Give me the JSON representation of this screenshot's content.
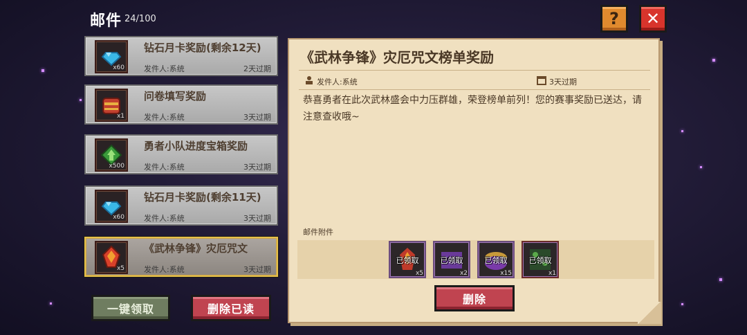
{
  "header": {
    "title": "邮件",
    "count": "24/100"
  },
  "buttons": {
    "help": "?",
    "close": "✕",
    "claim_all": "一键领取",
    "delete_read": "删除已读",
    "delete": "删除"
  },
  "mails": [
    {
      "title": "钻石月卡奖励(剩余12天)",
      "sender": "发件人:系统",
      "expire": "2天过期",
      "qty": "x60",
      "icon": "diamond-icon"
    },
    {
      "title": "问卷填写奖励",
      "sender": "发件人:系统",
      "expire": "3天过期",
      "qty": "x1",
      "icon": "chest-icon"
    },
    {
      "title": "勇者小队进度宝箱奖励",
      "sender": "发件人:系统",
      "expire": "3天过期",
      "qty": "x500",
      "icon": "green-gem-icon"
    },
    {
      "title": "钻石月卡奖励(剩余11天)",
      "sender": "发件人:系统",
      "expire": "3天过期",
      "qty": "x60",
      "icon": "diamond-icon"
    },
    {
      "title": "《武林争锋》灾厄咒文",
      "sender": "发件人:系统",
      "expire": "3天过期",
      "qty": "x5",
      "icon": "red-gem-icon",
      "selected": true
    }
  ],
  "detail": {
    "title": "《武林争锋》灾厄咒文榜单奖励",
    "sender": "发件人:系统",
    "expire": "3天过期",
    "body": "恭喜勇者在此次武林盛会中力压群雄，荣登榜单前列！您的赛事奖励已送达，请注意查收哦~",
    "attachments_label": "邮件附件",
    "attachments": [
      {
        "status": "已领取",
        "qty": "x5",
        "icon": "red-gem-icon"
      },
      {
        "status": "已领取",
        "qty": "x2",
        "icon": "purple-chest-icon"
      },
      {
        "status": "已领取",
        "qty": "x15",
        "icon": "purple-orb-icon"
      },
      {
        "status": "已领取",
        "qty": "x1",
        "icon": "green-scroll-icon"
      }
    ]
  },
  "colors": {
    "accent_gold": "#e6c14a",
    "danger": "#c04450",
    "paper": "#f0e0c0"
  }
}
